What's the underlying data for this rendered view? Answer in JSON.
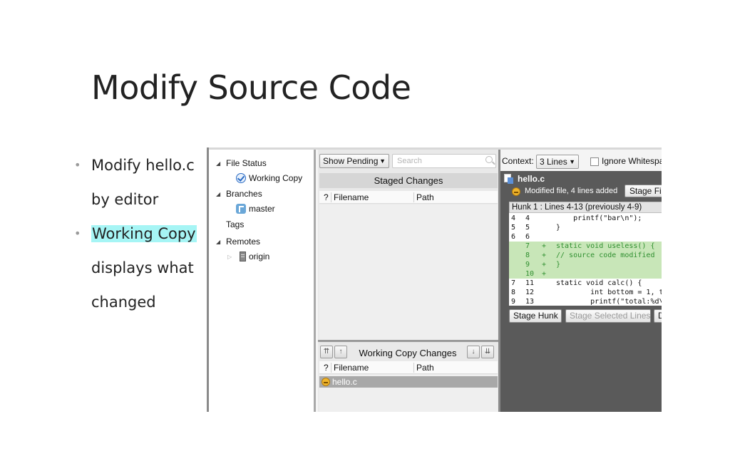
{
  "slide": {
    "title": "Modify Source Code",
    "bullets": [
      {
        "lines": [
          "Modify hello.c",
          "by editor"
        ]
      },
      {
        "highlight": "Working Copy",
        "lines": [
          "displays what",
          "changed"
        ]
      }
    ]
  },
  "tree": {
    "file_status": "File Status",
    "working_copy": "Working Copy",
    "branches": "Branches",
    "master": "master",
    "tags": "Tags",
    "remotes": "Remotes",
    "origin": "origin"
  },
  "middle": {
    "show_pending": "Show Pending",
    "search_placeholder": "Search",
    "staged_title": "Staged Changes",
    "col_status": "?",
    "col_filename": "Filename",
    "col_path": "Path",
    "working_title": "Working Copy Changes",
    "working_files": [
      "hello.c"
    ]
  },
  "diff": {
    "context_label": "Context:",
    "context_value": "3 Lines",
    "ignore_whitespace": "Ignore Whitespa",
    "file_name": "hello.c",
    "file_status": "Modified file, 4 lines added",
    "stage_file": "Stage File",
    "hunk_header": "Hunk 1 : Lines 4-13 (previously 4-9)",
    "lines": [
      {
        "old": "4",
        "new": "4",
        "mark": "",
        "text": "    printf(\"bar\\n\");",
        "added": false
      },
      {
        "old": "5",
        "new": "5",
        "mark": "",
        "text": "}",
        "added": false
      },
      {
        "old": "6",
        "new": "6",
        "mark": "",
        "text": "",
        "added": false
      },
      {
        "old": "",
        "new": "7",
        "mark": "+",
        "text": "static void useless() {",
        "added": true
      },
      {
        "old": "",
        "new": "8",
        "mark": "+",
        "text": "// source code modified",
        "added": true
      },
      {
        "old": "",
        "new": "9",
        "mark": "+",
        "text": "}",
        "added": true
      },
      {
        "old": "",
        "new": "10",
        "mark": "+",
        "text": "",
        "added": true
      },
      {
        "old": "7",
        "new": "11",
        "mark": "",
        "text": "static void calc() {",
        "added": false
      },
      {
        "old": "8",
        "new": "12",
        "mark": "",
        "text": "        int bottom = 1, to",
        "added": false
      },
      {
        "old": "9",
        "new": "13",
        "mark": "",
        "text": "        printf(\"total:%d\\n",
        "added": false
      }
    ],
    "stage_hunk": "Stage Hunk",
    "stage_selected": "Stage Selected Lines",
    "discard_partial": "D"
  }
}
